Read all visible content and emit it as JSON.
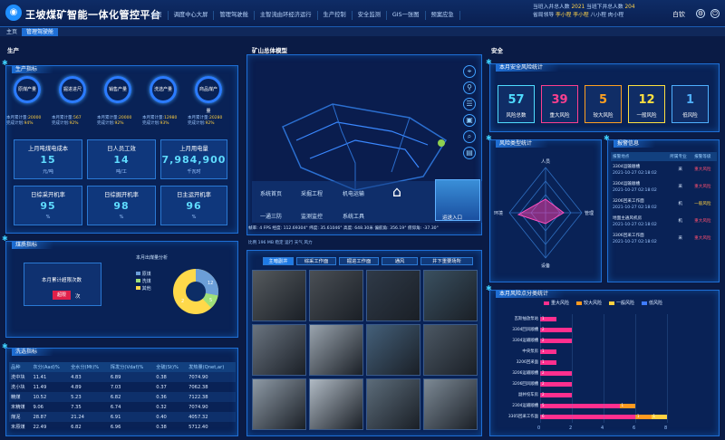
{
  "app": {
    "title": "王坡煤矿智能一体化管控平台",
    "logo": "logo-icon"
  },
  "nav": [
    "主页",
    "调度中心大屏",
    "管理驾驶舱",
    "主智流由环经济运行",
    "生产控制",
    "安全监测",
    "GIS一张图",
    "预案应急"
  ],
  "header_stats": {
    "line1": "当班入井总人数",
    "line1_v1": "2021",
    "line1_mid": "当班下井总人数",
    "line1_v2": "204",
    "line2_a": "省局领导",
    "line2_b": "李小程",
    "line2_c": "李小程",
    "line2_d": "八小程",
    "line2_e": "肉小程",
    "user": "白钦"
  },
  "tabs": [
    "主页",
    "管理驾驶舱"
  ],
  "sections": {
    "production": "生产",
    "model": "矿山总体模型",
    "safety": "安全"
  },
  "production": {
    "title": "生产指标",
    "gauges": [
      {
        "name": "原煤产量",
        "l1": "本月累计量:",
        "v1": "20000",
        "l2": "完成计划:",
        "v2": "94%"
      },
      {
        "name": "掘进进尺",
        "l1": "本月累计量:",
        "v1": "567",
        "l2": "完成计划:",
        "v2": "92%"
      },
      {
        "name": "销售产量",
        "l1": "本月累计量:",
        "v1": "20000",
        "l2": "完成计划:",
        "v2": "92%"
      },
      {
        "name": "洗选产量",
        "l1": "本月累计量:",
        "v1": "12980",
        "l2": "完成计划:",
        "v2": "93%"
      },
      {
        "name": "商品煤产量",
        "l1": "本月累计量:",
        "v1": "20280",
        "l2": "完成计划:",
        "v2": "92%"
      }
    ],
    "kpis": [
      {
        "title": "上月吨煤电成本",
        "value": "15",
        "unit": "元/吨"
      },
      {
        "title": "日人员工效",
        "value": "14",
        "unit": "吨/工"
      },
      {
        "title": "上月用电量",
        "value": "7,984,900",
        "unit": "千瓦时"
      },
      {
        "title": "日综采开机率",
        "value": "95",
        "unit": "%"
      },
      {
        "title": "日综掘开机率",
        "value": "98",
        "unit": "%"
      },
      {
        "title": "日主运开机率",
        "value": "96",
        "unit": "%"
      }
    ]
  },
  "coal_quality": {
    "title": "煤质指标",
    "label": "本月累计超限次数",
    "value": "超限",
    "unit": "次",
    "pie_title": "本月出煤量分析",
    "pie_values": [
      "12",
      "5",
      "2"
    ],
    "legend": [
      "原煤",
      "洗煤",
      "其他"
    ]
  },
  "quality_table": {
    "title": "洗选指标",
    "headers": [
      "品种",
      "灰分(Aad)%",
      "全水分(Mt)%",
      "挥发分(Vdaf)%",
      "全硫(St)%",
      "发热量(Qnet,ar)"
    ],
    "rows": [
      [
        "洗中块",
        "11.41",
        "4.83",
        "6.89",
        "0.38",
        "7074.90"
      ],
      [
        "洗小块",
        "11.49",
        "4.89",
        "7.03",
        "0.37",
        "7062.38"
      ],
      [
        "精煤",
        "10.52",
        "5.23",
        "6.82",
        "0.36",
        "7122.38"
      ],
      [
        "末精煤",
        "9.06",
        "7.35",
        "6.74",
        "0.32",
        "7074.90"
      ],
      [
        "煤泥",
        "28.87",
        "21.24",
        "6.91",
        "0.40",
        "4057.32"
      ],
      [
        "末原煤",
        "22.49",
        "6.82",
        "6.96",
        "0.38",
        "5712.40"
      ]
    ]
  },
  "model": {
    "nav_icons": [
      "locate-icon",
      "route-icon",
      "layers-icon",
      "cube-icon",
      "search-icon",
      "building-icon"
    ],
    "systems": [
      "系统首页",
      "采掘工程",
      "机电运输",
      "一通三防",
      "监测监控",
      "系统工具"
    ],
    "home_icon": "home-icon",
    "entry": "运送入口",
    "status": "帧率: 4 FPS 经度: 112.69304° 纬度: 35.61046° 高度: 648.30米 偏航角: 356.19° 俯仰角: -37.30°",
    "status2": "比例 196 MB 稳定 运行 天气 风力"
  },
  "video": {
    "tabs": [
      "主暗副井",
      "综采工作面",
      "掘进工作面",
      "通风",
      "井下重要场所"
    ]
  },
  "safety": {
    "risk_title": "本月安全风险统计",
    "risks": [
      {
        "value": "57",
        "label": "风险总数",
        "color": "#4fdcff"
      },
      {
        "value": "39",
        "label": "重大风险",
        "color": "#ff3f8e"
      },
      {
        "value": "5",
        "label": "较大风险",
        "color": "#ffa020"
      },
      {
        "value": "12",
        "label": "一般风险",
        "color": "#ffe040"
      },
      {
        "value": "1",
        "label": "低风险",
        "color": "#4fb0ff"
      }
    ],
    "radar_title": "风险类型统计",
    "radar_labels": [
      "人员",
      "管理",
      "设备",
      "环境"
    ],
    "alarm_title": "报警信息",
    "alarm_headers": [
      "报警地点",
      "所属专业",
      "报警等级"
    ],
    "alarms": [
      {
        "place": "3304运输顺槽",
        "time": "2021-10-27 02:18:02",
        "prof": "采",
        "level": "重大风险",
        "color": "#ff4f6f"
      },
      {
        "place": "3304运输顺槽",
        "time": "2021-10-27 02:18:02",
        "prof": "采",
        "level": "重大风险",
        "color": "#ff4f6f"
      },
      {
        "place": "3206回采工作面",
        "time": "2021-10-27 02:18:02",
        "prof": "机",
        "level": "一般风险",
        "color": "#ffd040"
      },
      {
        "place": "地面主通风机房",
        "time": "2021-10-27 02:18:02",
        "prof": "机",
        "level": "重大风险",
        "color": "#ff4f6f"
      },
      {
        "place": "3306回采工作面",
        "time": "2021-10-27 02:18:02",
        "prof": "采",
        "level": "重大风险",
        "color": "#ff4f6f"
      }
    ],
    "bar_title": "本月风险点分类统计"
  },
  "chart_data": {
    "type": "bar",
    "orientation": "horizontal",
    "stacked": true,
    "categories": [
      "瓦斯抽放泵站",
      "3304回风顺槽",
      "3304运输顺槽",
      "中央泵房",
      "3206回采面",
      "3206运输顺槽",
      "3206回风顺槽",
      "副井绞车房",
      "2304运输顺槽",
      "3305回采工作面"
    ],
    "series": [
      {
        "name": "低风险",
        "color": "#3f7cff",
        "values": [
          0,
          0,
          0,
          0,
          0,
          0,
          0,
          0,
          0,
          0
        ]
      },
      {
        "name": "一般风险",
        "color": "#ffd040",
        "values": [
          0,
          0,
          0,
          0,
          0,
          0,
          0,
          0,
          0,
          1
        ]
      },
      {
        "name": "较大风险",
        "color": "#ff9a20",
        "values": [
          0,
          0,
          0,
          0,
          0,
          0,
          0,
          0,
          1,
          1
        ]
      },
      {
        "name": "重大风险",
        "color": "#ff2f8e",
        "values": [
          1,
          2,
          2,
          1,
          1,
          2,
          2,
          2,
          5,
          6
        ]
      }
    ],
    "xlim": [
      0,
      8
    ],
    "xticks": [
      "0",
      "2",
      "4",
      "6",
      "8"
    ]
  }
}
